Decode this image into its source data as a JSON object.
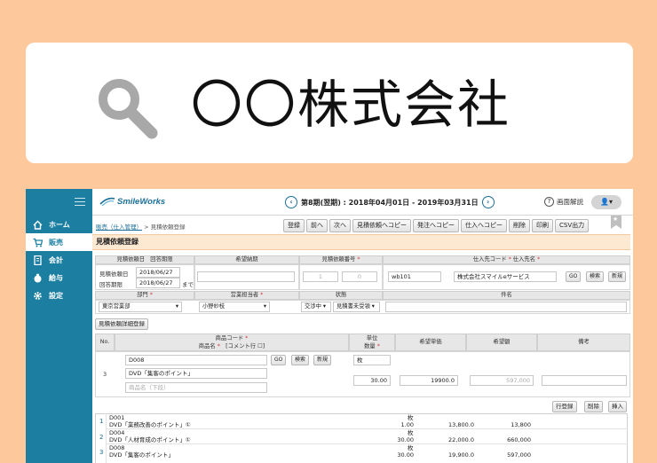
{
  "search": {
    "text": "〇〇株式会社"
  },
  "sidebar": {
    "items": [
      {
        "label": "ホーム",
        "icon": "home-icon"
      },
      {
        "label": "販売",
        "icon": "cart-icon"
      },
      {
        "label": "会計",
        "icon": "ledger-icon"
      },
      {
        "label": "給与",
        "icon": "moneybag-icon"
      },
      {
        "label": "設定",
        "icon": "gear-icon"
      }
    ]
  },
  "header": {
    "logo": "SmileWorks",
    "period": "第8期(翌期) : 2018年04月01日 - 2019年03月31日",
    "prev_symbol": "‹",
    "next_symbol": "›",
    "help": "画面解説",
    "user_symbol": "👤▾"
  },
  "breadcrumb": {
    "link": "販売（仕入管理）",
    "separator": " > ",
    "current": "見積依頼登録"
  },
  "toolbar": [
    "登録",
    "前へ",
    "次へ",
    "見積依頼へコピー",
    "発注へコピー",
    "仕入へコピー",
    "削除",
    "印刷",
    "CSV出力"
  ],
  "page_title": "見積依頼登録",
  "form": {
    "h_date": "見積依頼日　回答期限",
    "h_delivery": "希望納期",
    "h_number": "見積依頼番号",
    "h_supplier": "仕入先コード",
    "h_supplier_name": "仕入先名",
    "req": "*",
    "req_suffix": " *",
    "lbl_request_date": "見積依頼日",
    "request_date": "2018/06/27",
    "lbl_answer": "回答期限",
    "answer_date": "2018/06/27",
    "until": "まで",
    "number_1": "1",
    "number_2": "0",
    "supplier_code": "wb101",
    "supplier_name": "株式会社スマイルeサービス",
    "btn_go": "GO",
    "btn_search": "検索",
    "btn_new": "新規",
    "h_department": "部門",
    "h_staff": "営業担当者",
    "h_status": "状態",
    "h_subject": "件名",
    "department": "東京営業部",
    "staff": "小野紗枝",
    "status_1": "交渉中",
    "status_2": "見積書未受領",
    "detail_button": "見積依頼詳細登録"
  },
  "detail": {
    "h_no": "No.",
    "h_code": "商品コード",
    "h_name": "商品名",
    "h_comment": "[コメント行",
    "h_unit": "単位",
    "h_qty": "数量",
    "h_price": "希望単価",
    "h_amount": "希望額",
    "h_note": "備考",
    "row_no": "3",
    "code": "D008",
    "name": "DVD「集客のポイント」",
    "name_placeholder": "商品名（下段）",
    "unit": "枚",
    "qty": "30.00",
    "price": "19900.0",
    "amount": "597,000"
  },
  "row_buttons": [
    "行登録",
    "削除",
    "挿入"
  ],
  "list": [
    {
      "no": "1",
      "code": "D001",
      "name": "DVD「業務改善のポイント」①",
      "unit": "枚",
      "qty": "1.00",
      "price": "13,800.0",
      "amount": "13,800"
    },
    {
      "no": "2",
      "code": "D004",
      "name": "DVD「人材育成のポイント」①",
      "unit": "枚",
      "qty": "30.00",
      "price": "22,000.0",
      "amount": "660,000"
    },
    {
      "no": "3",
      "code": "D008",
      "name": "DVD「集客のポイント」",
      "unit": "枚",
      "qty": "30.00",
      "price": "19,900.0",
      "amount": "597,000"
    }
  ]
}
